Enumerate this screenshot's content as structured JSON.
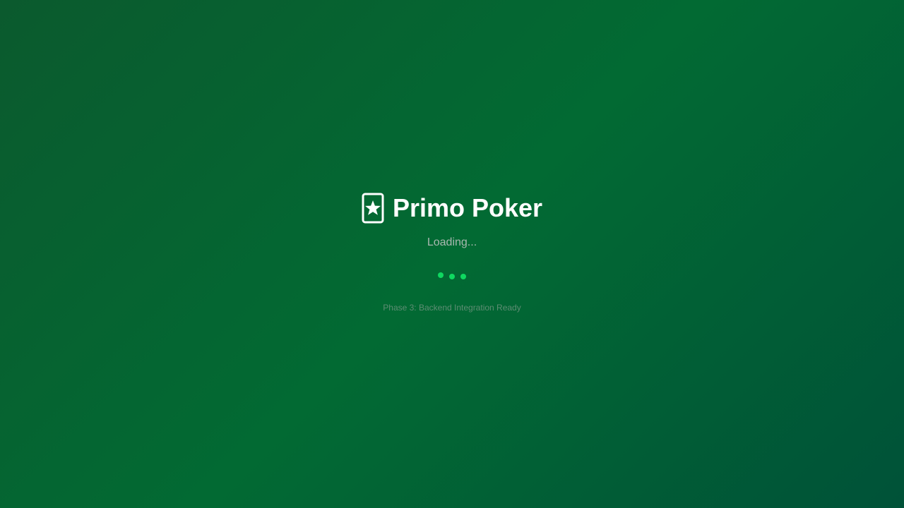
{
  "app": {
    "title": "Primo Poker",
    "logo_icon": "playing-card-star-icon"
  },
  "status": {
    "loading_text": "Loading...",
    "indicator": "three-dot-spinner",
    "phase_text": "Phase 3: Backend Integration Ready"
  },
  "colors": {
    "background_start": "#0b5a2e",
    "background_mid": "#026a33",
    "background_end": "#005238",
    "title": "#ffffff",
    "loading_text": "#a9b8b0",
    "dot_accent": "#0fd860",
    "phase_text": "#5e8d73"
  }
}
